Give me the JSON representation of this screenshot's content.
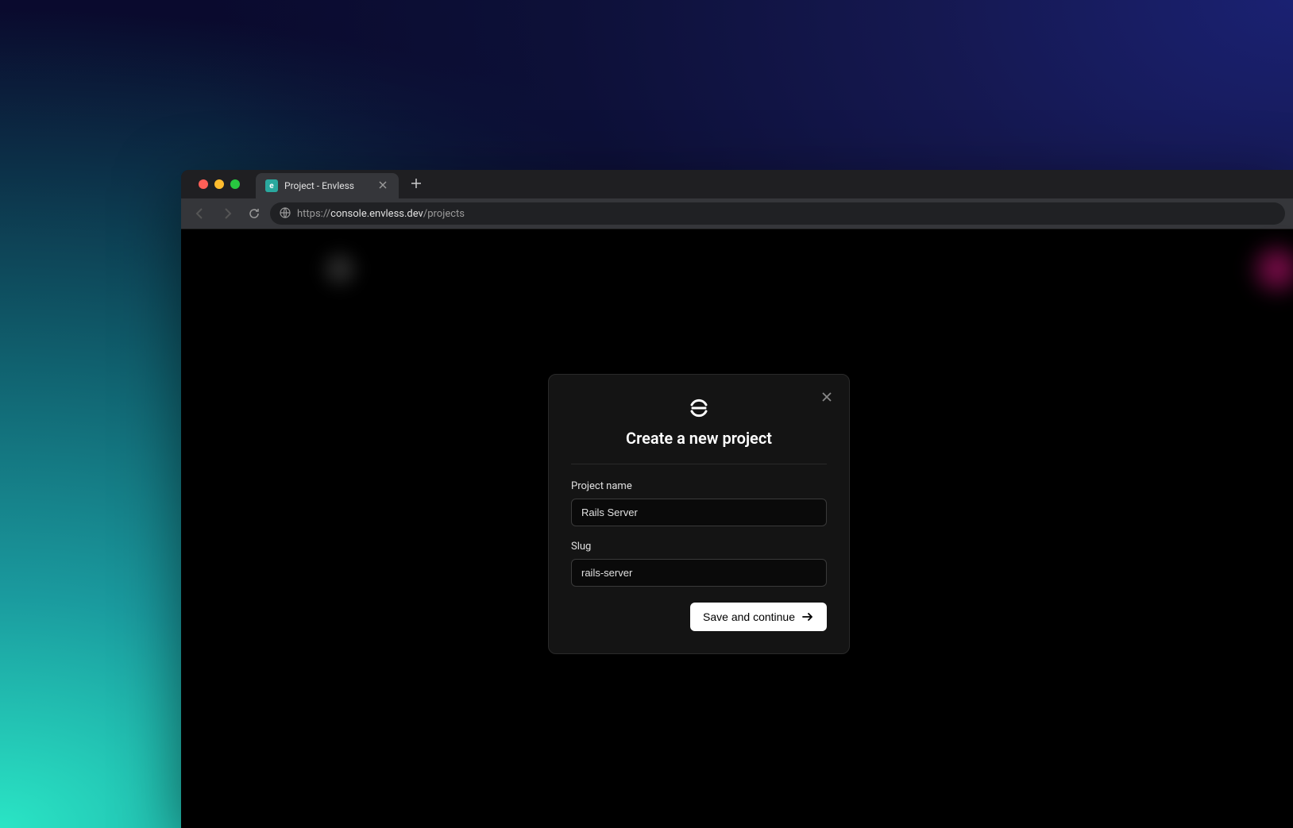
{
  "browser": {
    "tab_title": "Project - Envless",
    "url_protocol": "https://",
    "url_domain": "console.envless.dev",
    "url_path": "/projects"
  },
  "modal": {
    "title": "Create a new project",
    "project_name_label": "Project name",
    "project_name_value": "Rails Server",
    "slug_label": "Slug",
    "slug_value": "rails-server",
    "submit_label": "Save and continue"
  }
}
